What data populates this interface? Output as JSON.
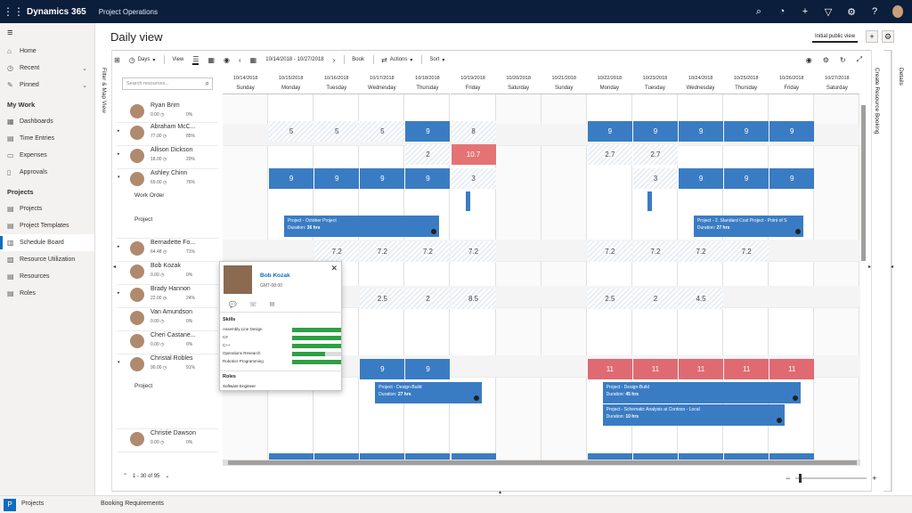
{
  "topbar": {
    "brand": "Dynamics 365",
    "app": "Project Operations"
  },
  "nav": {
    "home": "Home",
    "recent": "Recent",
    "pinned": "Pinned",
    "sec_work": "My Work",
    "dashboards": "Dashboards",
    "time": "Time Entries",
    "expenses": "Expenses",
    "approvals": "Approvals",
    "sec_projects": "Projects",
    "projects": "Projects",
    "templates": "Project Templates",
    "schedule": "Schedule Board",
    "util": "Resource Utilization",
    "resources": "Resources",
    "roles": "Roles"
  },
  "page": {
    "title": "Daily view",
    "view_name": "Initial public view"
  },
  "strips": {
    "filter": "Filter & Map View",
    "create": "Create Resource Booking",
    "details": "Details"
  },
  "toolbar": {
    "days": "Days",
    "view": "View",
    "range": "10/14/2018 - 10/27/2018",
    "book": "Book",
    "actions": "Actions",
    "sort": "Sort"
  },
  "search": {
    "placeholder": "Search resources..."
  },
  "days": [
    {
      "date": "10/14/2018",
      "dow": "Sunday"
    },
    {
      "date": "10/15/2018",
      "dow": "Monday"
    },
    {
      "date": "10/16/2018",
      "dow": "Tuesday"
    },
    {
      "date": "10/17/2018",
      "dow": "Wednesday"
    },
    {
      "date": "10/18/2018",
      "dow": "Thursday"
    },
    {
      "date": "10/19/2018",
      "dow": "Friday"
    },
    {
      "date": "10/20/2018",
      "dow": "Saturday"
    },
    {
      "date": "10/21/2018",
      "dow": "Sunday"
    },
    {
      "date": "10/22/2018",
      "dow": "Monday"
    },
    {
      "date": "10/23/2018",
      "dow": "Tuesday"
    },
    {
      "date": "10/24/2018",
      "dow": "Wednesday"
    },
    {
      "date": "10/25/2018",
      "dow": "Thursday"
    },
    {
      "date": "10/26/2018",
      "dow": "Friday"
    },
    {
      "date": "10/27/2018",
      "dow": "Saturday"
    }
  ],
  "resources": [
    {
      "name": "Ryan Brim",
      "hours": "0.00",
      "pct": "0%"
    },
    {
      "name": "Abraham McC...",
      "hours": "77.00",
      "pct": "85%"
    },
    {
      "name": "Allison Dickson",
      "hours": "18.00",
      "pct": "20%"
    },
    {
      "name": "Ashley Chinn",
      "hours": "69.00",
      "pct": "76%"
    },
    {
      "name": "Bernadette Fo...",
      "hours": "64.48",
      "pct": "71%"
    },
    {
      "name": "Bob Kozak",
      "hours": "0.00",
      "pct": "0%"
    },
    {
      "name": "Brady Hannon",
      "hours": "22.00",
      "pct": "24%"
    },
    {
      "name": "Van Amundson",
      "hours": "0.00",
      "pct": "0%"
    },
    {
      "name": "Cheri Castane...",
      "hours": "0.00",
      "pct": "0%"
    },
    {
      "name": "Christal Robles",
      "hours": "90.00",
      "pct": "91%"
    },
    {
      "name": "Christie Dawson",
      "hours": "0.00",
      "pct": "0%"
    }
  ],
  "sublabels": {
    "work_order": "Work Order",
    "project": "Project",
    "project2": "Project"
  },
  "cells": {
    "abraham": [
      "5",
      "5",
      "5",
      "9",
      "8",
      "9",
      "9",
      "9",
      "9",
      "9"
    ],
    "allison": [
      "2",
      "10.7",
      "2.7",
      "2.7"
    ],
    "ashley": [
      "9",
      "9",
      "9",
      "9",
      "3",
      "3",
      "9",
      "9",
      "9"
    ],
    "bernadette": [
      "7.2",
      "7.2",
      "7.2",
      "7.2",
      "7.2",
      "7.2",
      "7.2",
      "7.2"
    ],
    "brady": [
      "2.5",
      "2",
      "8.5",
      "2.5",
      "2",
      "4.5"
    ],
    "christal": [
      "9",
      "9",
      "11",
      "11",
      "11",
      "11",
      "11"
    ]
  },
  "bookings": [
    {
      "title": "Project - October Project",
      "dur": "Duration: ",
      "hrs": "36 hrs"
    },
    {
      "title": "Project - 2. Standard Cost Project - Point of S",
      "dur": "Duration: ",
      "hrs": "27 hrs"
    },
    {
      "title": "Project - Design-Build",
      "dur": "Duration: ",
      "hrs": "27 hrs"
    },
    {
      "title": "Project - Design-Build",
      "dur": "Duration: ",
      "hrs": "45 hrs"
    },
    {
      "title": "Project - Schematic Analysis at Contoso - Local",
      "dur": "Duration: ",
      "hrs": "10 hrs"
    }
  ],
  "card": {
    "name": "Bob Kozak",
    "tz": "GMT-08:00",
    "skills_label": "Skills",
    "roles_label": "Roles",
    "role": "Software Engineer",
    "skills": [
      {
        "name": "Assembly Line Design",
        "level": 1.0
      },
      {
        "name": "C#",
        "level": 1.0
      },
      {
        "name": "C++",
        "level": 1.0
      },
      {
        "name": "Operations Research",
        "level": 0.67
      },
      {
        "name": "Robotics Programming",
        "level": 1.0
      }
    ]
  },
  "pager": {
    "text": "1 - 30 of 95"
  },
  "bottom": {
    "app": "Projects",
    "tab": "Booking Requirements"
  }
}
